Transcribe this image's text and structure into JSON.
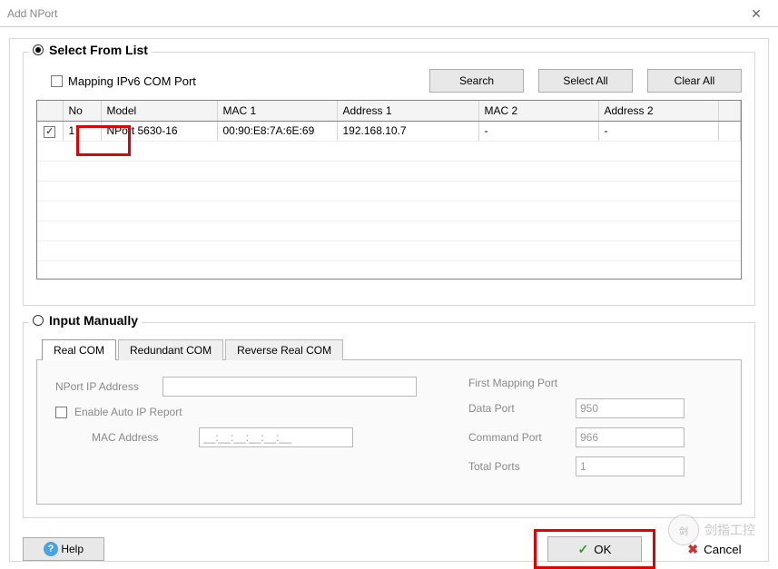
{
  "window": {
    "title": "Add NPort",
    "close_glyph": "✕"
  },
  "select_from_list": {
    "title": "Select From List",
    "mapping_label": "Mapping IPv6 COM Port",
    "buttons": {
      "search": "Search",
      "select_all": "Select All",
      "clear_all": "Clear All"
    },
    "columns": {
      "no": "No",
      "model": "Model",
      "mac1": "MAC 1",
      "addr1": "Address 1",
      "mac2": "MAC 2",
      "addr2": "Address 2"
    },
    "rows": [
      {
        "checked": true,
        "no": "1",
        "model": "NPort 5630-16",
        "mac1": "00:90:E8:7A:6E:69",
        "addr1": "192.168.10.7",
        "mac2": "-",
        "addr2": "-"
      }
    ]
  },
  "input_manually": {
    "title": "Input Manually",
    "tabs": {
      "real_com": "Real COM",
      "redundant_com": "Redundant COM",
      "reverse_real_com": "Reverse Real COM"
    },
    "form": {
      "nport_ip_label": "NPort IP Address",
      "nport_ip_value": "",
      "enable_auto_ip": "Enable Auto IP Report",
      "mac_address_label": "MAC Address",
      "mac_address_value": "__:__:__:__:__:__",
      "first_mapping_port_label": "First Mapping Port",
      "data_port_label": "Data Port",
      "data_port_value": "950",
      "command_port_label": "Command Port",
      "command_port_value": "966",
      "total_ports_label": "Total Ports",
      "total_ports_value": "1"
    }
  },
  "buttons": {
    "help": "Help",
    "ok": "OK",
    "cancel": "Cancel"
  },
  "watermark": "剑指工控"
}
